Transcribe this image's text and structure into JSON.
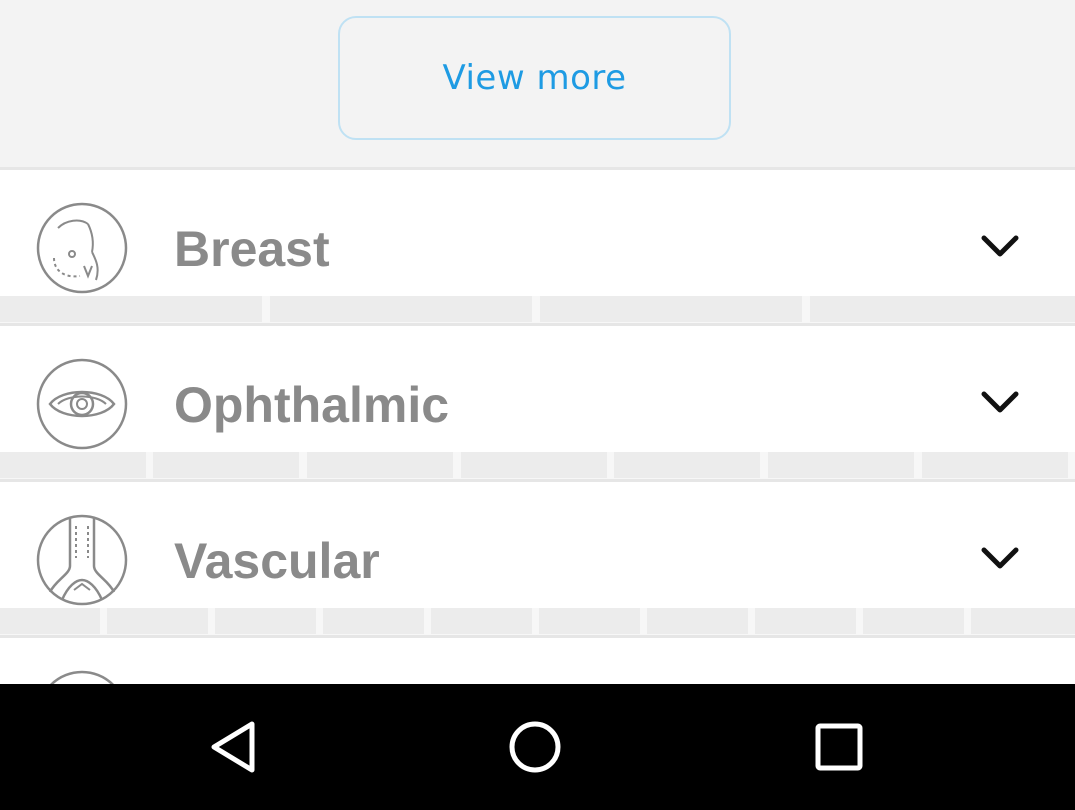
{
  "view_more": {
    "label": "View more"
  },
  "categories": [
    {
      "label": "Breast",
      "icon": "breast-icon"
    },
    {
      "label": "Ophthalmic",
      "icon": "eye-icon"
    },
    {
      "label": "Vascular",
      "icon": "vascular-icon"
    }
  ],
  "navbar": {
    "back": "back-triangle-icon",
    "home": "home-circle-icon",
    "recents": "recents-square-icon"
  },
  "colors": {
    "accent": "#1e9be3",
    "button_border": "#bfe1f3",
    "label_gray": "#8a8a8a",
    "background": "#f3f3f3"
  }
}
